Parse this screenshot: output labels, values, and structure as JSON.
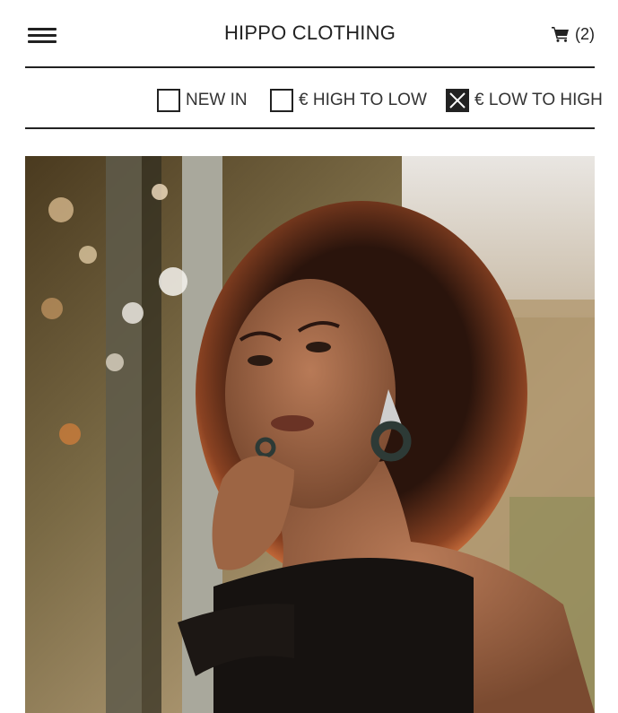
{
  "header": {
    "brand": "HIPPO CLOTHING",
    "cart_count": "(2)",
    "menu_icon": "hamburger-menu-icon",
    "cart_icon": "shopping-cart-icon"
  },
  "filters": [
    {
      "label": "NEW IN",
      "checked": false
    },
    {
      "label": "€ HIGH TO LOW",
      "checked": false
    },
    {
      "label": "€ LOW TO HIGH",
      "checked": true
    }
  ],
  "colors": {
    "text": "#222222",
    "background": "#ffffff"
  }
}
